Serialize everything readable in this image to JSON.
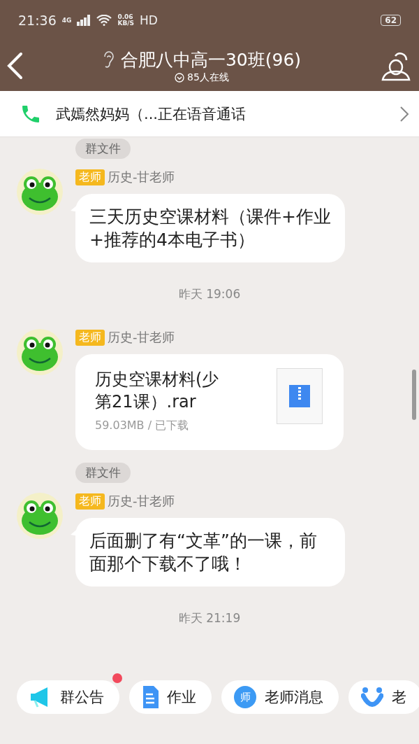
{
  "status_bar": {
    "time": "21:36",
    "network": "4G",
    "speed_value": "0.06",
    "speed_unit": "KB/S",
    "hd": "HD",
    "battery": "62"
  },
  "header": {
    "title": "合肥八中高一30班(96)",
    "online": "85人在线"
  },
  "call_bar": {
    "text": "武嫣然妈妈（...正在语音通话"
  },
  "messages": [
    {
      "kind": "tag",
      "text": "群文件"
    },
    {
      "kind": "text",
      "role": "老师",
      "sender": "历史-甘老师",
      "text": "三天历史空课材料（课件+作业+推荐的4本电子书）"
    },
    {
      "kind": "time",
      "text": "昨天 19:06"
    },
    {
      "kind": "file",
      "role": "老师",
      "sender": "历史-甘老师",
      "file_name": "历史空课材料(少第21课）.rar",
      "file_info": "59.03MB / 已下载"
    },
    {
      "kind": "tag",
      "text": "群文件"
    },
    {
      "kind": "text",
      "role": "老师",
      "sender": "历史-甘老师",
      "text": "后面删了有“文革”的一课，前面那个下载不了哦！"
    },
    {
      "kind": "time",
      "text": "昨天 21:19"
    }
  ],
  "shortcuts": [
    {
      "kind": "megaphone",
      "label": "群公告",
      "unread": true
    },
    {
      "kind": "document",
      "label": "作业",
      "unread": false
    },
    {
      "kind": "teacher",
      "label": "老师消息",
      "unread": false,
      "icon_text": "师"
    },
    {
      "kind": "smile",
      "label": "老",
      "unread": false
    }
  ]
}
